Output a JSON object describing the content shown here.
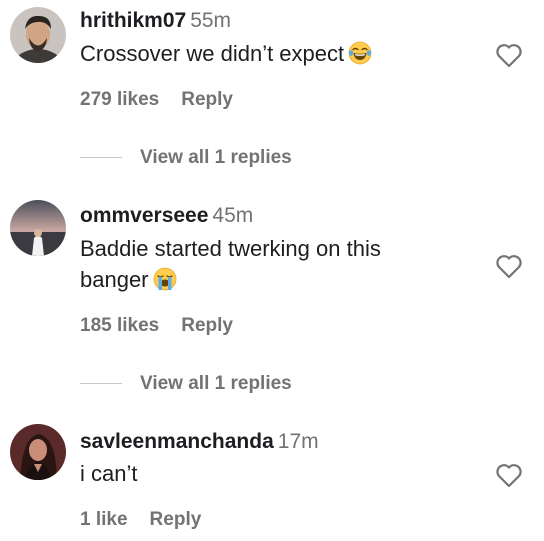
{
  "comments": [
    {
      "username": "hrithikm07",
      "time": "55m",
      "text": "Crossover we didn’t expect",
      "emoji": "tears-of-joy-emoji",
      "likes": "279 likes",
      "reply_label": "Reply",
      "view_replies": "View all 1 replies",
      "avatar_icon": "profile-photo-man"
    },
    {
      "username": "ommverseee",
      "time": "45m",
      "text": "Baddie started twerking on this banger",
      "emoji": "loudly-crying-emoji",
      "likes": "185 likes",
      "reply_label": "Reply",
      "view_replies": "View all 1 replies",
      "avatar_icon": "profile-photo-sunset"
    },
    {
      "username": "savleenmanchanda",
      "time": "17m",
      "text": "i can’t",
      "likes": "1 like",
      "reply_label": "Reply",
      "avatar_icon": "profile-photo-woman"
    }
  ],
  "colors": {
    "text": "#1c1e21",
    "secondary": "#737373",
    "emoji_face": "#ffcc4d",
    "tears": "#5dadec"
  },
  "icons": {
    "like": "heart-outline-icon"
  }
}
